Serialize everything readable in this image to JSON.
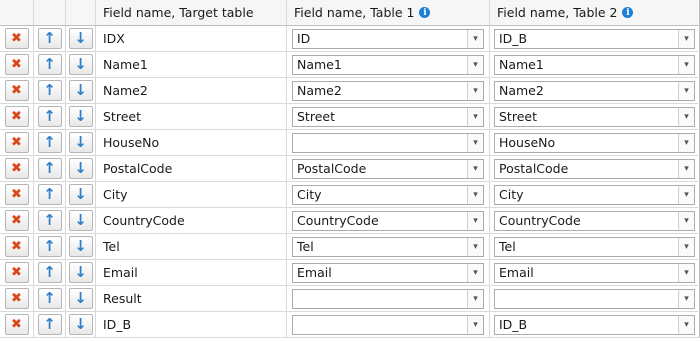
{
  "headers": {
    "target": "Field name, Target table",
    "table1": "Field name, Table 1",
    "table2": "Field name, Table 2",
    "info_glyph": "i"
  },
  "icons": {
    "delete": "✖",
    "up": "↑",
    "down": "↓",
    "dropdown": "▾"
  },
  "colors": {
    "delete": "#d9471d",
    "arrow": "#2f80c9",
    "info": "#1e7fd6"
  },
  "rows": [
    {
      "target": "IDX",
      "table1": "ID",
      "table2": "ID_B"
    },
    {
      "target": "Name1",
      "table1": "Name1",
      "table2": "Name1"
    },
    {
      "target": "Name2",
      "table1": "Name2",
      "table2": "Name2"
    },
    {
      "target": "Street",
      "table1": "Street",
      "table2": "Street"
    },
    {
      "target": "HouseNo",
      "table1": "",
      "table2": "HouseNo"
    },
    {
      "target": "PostalCode",
      "table1": "PostalCode",
      "table2": "PostalCode"
    },
    {
      "target": "City",
      "table1": "City",
      "table2": "City"
    },
    {
      "target": "CountryCode",
      "table1": "CountryCode",
      "table2": "CountryCode"
    },
    {
      "target": "Tel",
      "table1": "Tel",
      "table2": "Tel"
    },
    {
      "target": "Email",
      "table1": "Email",
      "table2": "Email"
    },
    {
      "target": "Result",
      "table1": "",
      "table2": ""
    },
    {
      "target": "ID_B",
      "table1": "",
      "table2": "ID_B"
    }
  ]
}
